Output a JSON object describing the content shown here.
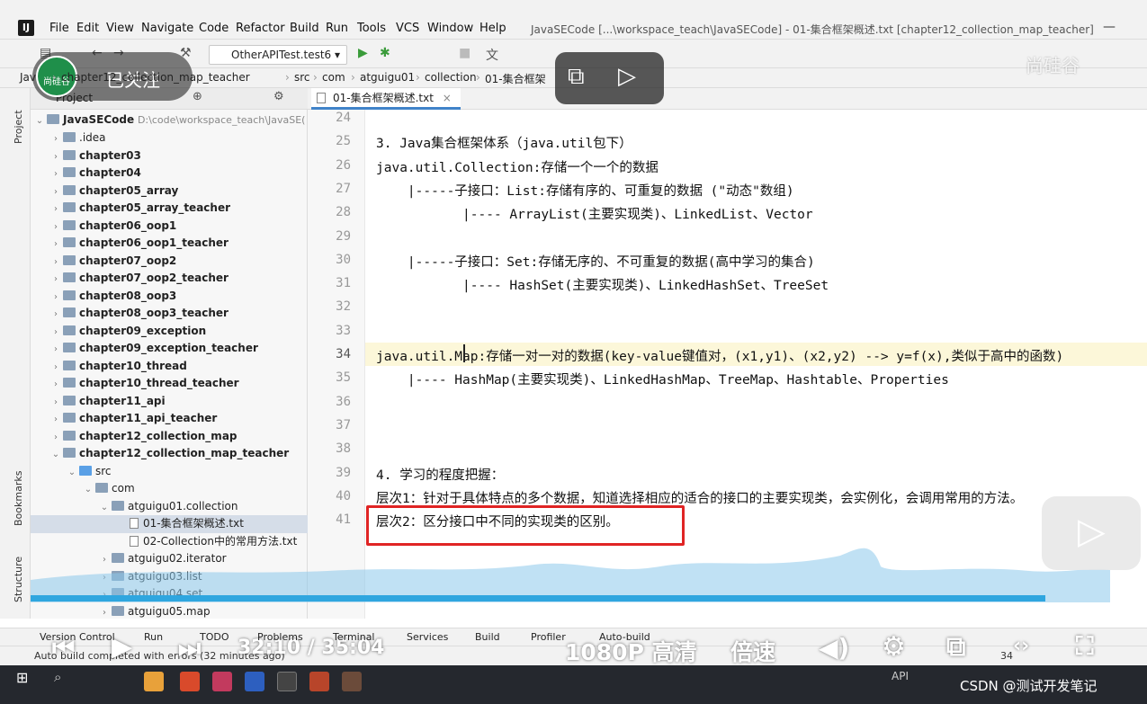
{
  "window": {
    "menus": [
      "File",
      "Edit",
      "View",
      "Navigate",
      "Code",
      "Refactor",
      "Build",
      "Run",
      "Tools",
      "VCS",
      "Window",
      "Help"
    ],
    "title": "JavaSECode [...\\workspace_teach\\JavaSECode] - 01-集合框架概述.txt [chapter12_collection_map_teacher]",
    "minimize": "—"
  },
  "toolbar": {
    "run_config": "OtherAPITest.test6"
  },
  "breadcrumb": [
    "Jav",
    "chapter12_collection_map_teacher",
    "src",
    "com",
    "atguigu01",
    "collection",
    "01-集合框架"
  ],
  "project": {
    "header": "Project",
    "root": {
      "name": "JavaSECode",
      "path": "D:\\code\\workspace_teach\\JavaSE("
    },
    "items": [
      {
        "label": ".idea",
        "depth": 1,
        "arrow": "›"
      },
      {
        "label": "chapter03",
        "depth": 1,
        "arrow": "›",
        "bold": true
      },
      {
        "label": "chapter04",
        "depth": 1,
        "arrow": "›",
        "bold": true
      },
      {
        "label": "chapter05_array",
        "depth": 1,
        "arrow": "›",
        "bold": true
      },
      {
        "label": "chapter05_array_teacher",
        "depth": 1,
        "arrow": "›",
        "bold": true
      },
      {
        "label": "chapter06_oop1",
        "depth": 1,
        "arrow": "›",
        "bold": true
      },
      {
        "label": "chapter06_oop1_teacher",
        "depth": 1,
        "arrow": "›",
        "bold": true
      },
      {
        "label": "chapter07_oop2",
        "depth": 1,
        "arrow": "›",
        "bold": true
      },
      {
        "label": "chapter07_oop2_teacher",
        "depth": 1,
        "arrow": "›",
        "bold": true
      },
      {
        "label": "chapter08_oop3",
        "depth": 1,
        "arrow": "›",
        "bold": true
      },
      {
        "label": "chapter08_oop3_teacher",
        "depth": 1,
        "arrow": "›",
        "bold": true
      },
      {
        "label": "chapter09_exception",
        "depth": 1,
        "arrow": "›",
        "bold": true
      },
      {
        "label": "chapter09_exception_teacher",
        "depth": 1,
        "arrow": "›",
        "bold": true
      },
      {
        "label": "chapter10_thread",
        "depth": 1,
        "arrow": "›",
        "bold": true
      },
      {
        "label": "chapter10_thread_teacher",
        "depth": 1,
        "arrow": "›",
        "bold": true
      },
      {
        "label": "chapter11_api",
        "depth": 1,
        "arrow": "›",
        "bold": true
      },
      {
        "label": "chapter11_api_teacher",
        "depth": 1,
        "arrow": "›",
        "bold": true
      },
      {
        "label": "chapter12_collection_map",
        "depth": 1,
        "arrow": "›",
        "bold": true
      },
      {
        "label": "chapter12_collection_map_teacher",
        "depth": 1,
        "arrow": "⌄",
        "bold": true
      },
      {
        "label": "src",
        "depth": 2,
        "arrow": "⌄",
        "src": true
      },
      {
        "label": "com",
        "depth": 3,
        "arrow": "⌄"
      },
      {
        "label": "atguigu01.collection",
        "depth": 4,
        "arrow": "⌄"
      },
      {
        "label": "01-集合框架概述.txt",
        "depth": 5,
        "arrow": "",
        "file": true,
        "selected": true
      },
      {
        "label": "02-Collection中的常用方法.txt",
        "depth": 5,
        "arrow": "",
        "file": true
      },
      {
        "label": "atguigu02.iterator",
        "depth": 4,
        "arrow": "›"
      },
      {
        "label": "atguigu03.list",
        "depth": 4,
        "arrow": "›"
      },
      {
        "label": "atguigu04.set",
        "depth": 4,
        "arrow": "›"
      },
      {
        "label": "atguigu05.map",
        "depth": 4,
        "arrow": "›"
      }
    ]
  },
  "left_strip": {
    "project": "Project",
    "bookmarks": "Bookmarks",
    "structure": "Structure"
  },
  "editor": {
    "tab": "01-集合框架概述.txt",
    "lines": [
      {
        "n": "24",
        "text": ""
      },
      {
        "n": "25",
        "text": "3. Java集合框架体系（java.util包下）"
      },
      {
        "n": "26",
        "text": "java.util.Collection:存储一个一个的数据"
      },
      {
        "n": "27",
        "text": "    |-----子接口：List:存储有序的、可重复的数据 (\"动态\"数组)"
      },
      {
        "n": "28",
        "text": "           |---- ArrayList(主要实现类)、LinkedList、Vector"
      },
      {
        "n": "29",
        "text": ""
      },
      {
        "n": "30",
        "text": "    |-----子接口：Set:存储无序的、不可重复的数据(高中学习的集合)"
      },
      {
        "n": "31",
        "text": "           |---- HashSet(主要实现类)、LinkedHashSet、TreeSet"
      },
      {
        "n": "32",
        "text": ""
      },
      {
        "n": "33",
        "text": ""
      },
      {
        "n": "34",
        "text": "java.util.Map:存储一对一对的数据(key-value键值对，(x1,y1)、(x2,y2) --> y=f(x),类似于高中的函数)"
      },
      {
        "n": "35",
        "text": "    |---- HashMap(主要实现类)、LinkedHashMap、TreeMap、Hashtable、Properties"
      },
      {
        "n": "36",
        "text": ""
      },
      {
        "n": "37",
        "text": ""
      },
      {
        "n": "38",
        "text": ""
      },
      {
        "n": "39",
        "text": "4. 学习的程度把握："
      },
      {
        "n": "40",
        "text": "层次1：针对于具体特点的多个数据，知道选择相应的适合的接口的主要实现类，会实例化，会调用常用的方法。"
      },
      {
        "n": "41",
        "text": "层次2：区分接口中不同的实现类的区别。"
      }
    ]
  },
  "tool_windows": [
    "Version Control",
    "Run",
    "TODO",
    "Problems",
    "Terminal",
    "Services",
    "Build",
    "Profiler",
    "Auto-build"
  ],
  "status": {
    "message": "Auto build completed with errors (32 minutes ago)",
    "right": "34"
  },
  "video": {
    "follow_label": "已关注",
    "avatar_text": "尚硅谷",
    "watermark": "尚硅谷",
    "time_current": "32:10",
    "time_sep": "/",
    "time_total": "35:04",
    "quality": "1080P 高清",
    "speed": "倍速",
    "progress_fraction": 0.94
  },
  "taskbar": {
    "api_label": "API",
    "credit": "CSDN @测试开发笔记"
  }
}
